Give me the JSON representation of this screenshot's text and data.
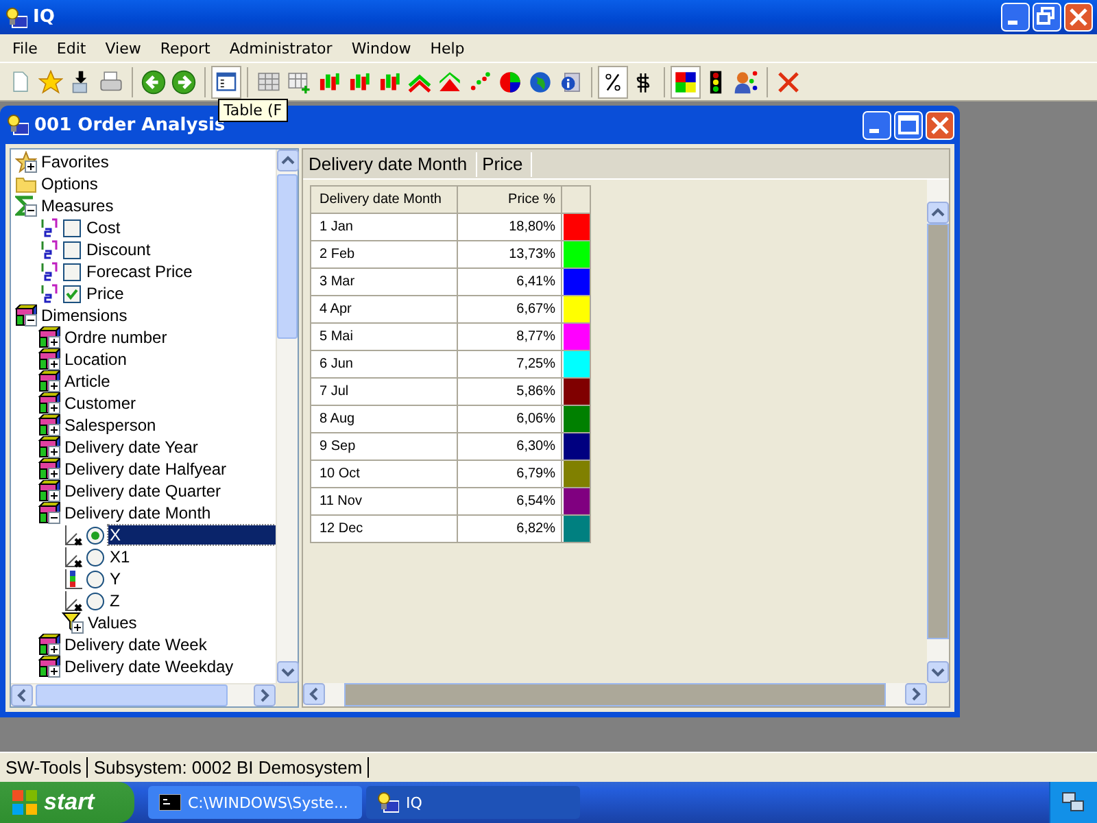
{
  "window": {
    "title": "IQ"
  },
  "menu": [
    "File",
    "Edit",
    "View",
    "Report",
    "Administrator",
    "Window",
    "Help"
  ],
  "toolbar": [
    {
      "kind": "new",
      "pressed": false
    },
    {
      "kind": "favorite",
      "pressed": false
    },
    {
      "kind": "import",
      "pressed": false
    },
    {
      "kind": "print",
      "pressed": false
    },
    {
      "kind": "separator"
    },
    {
      "kind": "back",
      "pressed": false
    },
    {
      "kind": "forward",
      "pressed": false
    },
    {
      "kind": "separator"
    },
    {
      "kind": "form",
      "pressed": true
    },
    {
      "kind": "separator"
    },
    {
      "kind": "table",
      "pressed": false
    },
    {
      "kind": "table-add",
      "pressed": false
    },
    {
      "kind": "chart-bar",
      "pressed": false
    },
    {
      "kind": "chart-bar",
      "pressed": false
    },
    {
      "kind": "chart-bar",
      "pressed": false
    },
    {
      "kind": "chart-line",
      "pressed": false
    },
    {
      "kind": "chart-area",
      "pressed": false
    },
    {
      "kind": "chart-scatter",
      "pressed": false
    },
    {
      "kind": "chart-pie",
      "pressed": false
    },
    {
      "kind": "globe",
      "pressed": false
    },
    {
      "kind": "info",
      "pressed": false
    },
    {
      "kind": "separator"
    },
    {
      "kind": "percent",
      "pressed": true
    },
    {
      "kind": "number",
      "pressed": false
    },
    {
      "kind": "separator"
    },
    {
      "kind": "colors",
      "pressed": true
    },
    {
      "kind": "traffic-light",
      "pressed": false
    },
    {
      "kind": "person",
      "pressed": false
    },
    {
      "kind": "separator"
    },
    {
      "kind": "delete",
      "pressed": false
    }
  ],
  "tooltip": "Table (F",
  "child_window": {
    "title": "001  Order Analysis"
  },
  "tree": [
    {
      "label": "Favorites",
      "kind": "favorites",
      "expanded": false,
      "selected": false
    },
    {
      "label": "Options",
      "kind": "folder",
      "selected": false
    },
    {
      "label": "Measures",
      "kind": "measures",
      "expanded": true,
      "selected": false,
      "children": [
        {
          "label": "Cost",
          "kind": "measure",
          "checked": false,
          "selected": false
        },
        {
          "label": "Discount",
          "kind": "measure",
          "checked": false,
          "selected": false
        },
        {
          "label": "Forecast Price",
          "kind": "measure",
          "checked": false,
          "selected": false
        },
        {
          "label": "Price",
          "kind": "measure",
          "checked": true,
          "selected": false
        }
      ]
    },
    {
      "label": "Dimensions",
      "kind": "dimensions",
      "expanded": true,
      "selected": false,
      "children": [
        {
          "label": "Ordre number",
          "kind": "dimension",
          "expanded": false,
          "selected": false
        },
        {
          "label": "Location",
          "kind": "dimension",
          "expanded": false,
          "selected": false
        },
        {
          "label": "Article",
          "kind": "dimension",
          "expanded": false,
          "selected": false
        },
        {
          "label": "Customer",
          "kind": "dimension",
          "expanded": false,
          "selected": false
        },
        {
          "label": "Salesperson",
          "kind": "dimension",
          "expanded": false,
          "selected": false
        },
        {
          "label": "Delivery date Year",
          "kind": "dimension",
          "expanded": false,
          "selected": false
        },
        {
          "label": "Delivery date Halfyear",
          "kind": "dimension",
          "expanded": false,
          "selected": false
        },
        {
          "label": "Delivery date Quarter",
          "kind": "dimension",
          "expanded": false,
          "selected": false
        },
        {
          "label": "Delivery date Month",
          "kind": "dimension",
          "expanded": true,
          "selected": false,
          "children": [
            {
              "label": "X",
              "kind": "axis-x",
              "selected": true
            },
            {
              "label": "X1",
              "kind": "axis-x1",
              "selected": false
            },
            {
              "label": "Y",
              "kind": "axis-y",
              "selected": false
            },
            {
              "label": "Z",
              "kind": "axis-z",
              "selected": false
            },
            {
              "label": "Values",
              "kind": "filter",
              "expanded": false,
              "selected": false
            }
          ]
        },
        {
          "label": "Delivery date Week",
          "kind": "dimension",
          "expanded": false,
          "selected": false
        },
        {
          "label": "Delivery date Weekday",
          "kind": "dimension",
          "expanded": false,
          "selected": false
        }
      ]
    }
  ],
  "header_fields": [
    "Delivery date Month",
    "Price"
  ],
  "table": {
    "columns": [
      "Delivery date Month",
      "Price %"
    ],
    "rows": [
      {
        "month": "1 Jan",
        "value": "18,80%",
        "color": "#ff0000"
      },
      {
        "month": "2 Feb",
        "value": "13,73%",
        "color": "#00ff00"
      },
      {
        "month": "3 Mar",
        "value": "6,41%",
        "color": "#0000ff"
      },
      {
        "month": "4 Apr",
        "value": "6,67%",
        "color": "#ffff00"
      },
      {
        "month": "5 Mai",
        "value": "8,77%",
        "color": "#ff00ff"
      },
      {
        "month": "6 Jun",
        "value": "7,25%",
        "color": "#00ffff"
      },
      {
        "month": "7 Jul",
        "value": "5,86%",
        "color": "#800000"
      },
      {
        "month": "8 Aug",
        "value": "6,06%",
        "color": "#008000"
      },
      {
        "month": "9 Sep",
        "value": "6,30%",
        "color": "#000080"
      },
      {
        "month": "10 Oct",
        "value": "6,79%",
        "color": "#808000"
      },
      {
        "month": "11 Nov",
        "value": "6,54%",
        "color": "#800080"
      },
      {
        "month": "12 Dec",
        "value": "6,82%",
        "color": "#008080"
      }
    ]
  },
  "status_bar": [
    "SW-Tools",
    "Subsystem: 0002 BI Demosystem"
  ],
  "taskbar": {
    "start": "start",
    "tasks": [
      {
        "label": "C:\\WINDOWS\\Syste...",
        "kind": "console",
        "selected": false
      },
      {
        "label": "IQ",
        "kind": "app",
        "selected": true
      }
    ]
  }
}
